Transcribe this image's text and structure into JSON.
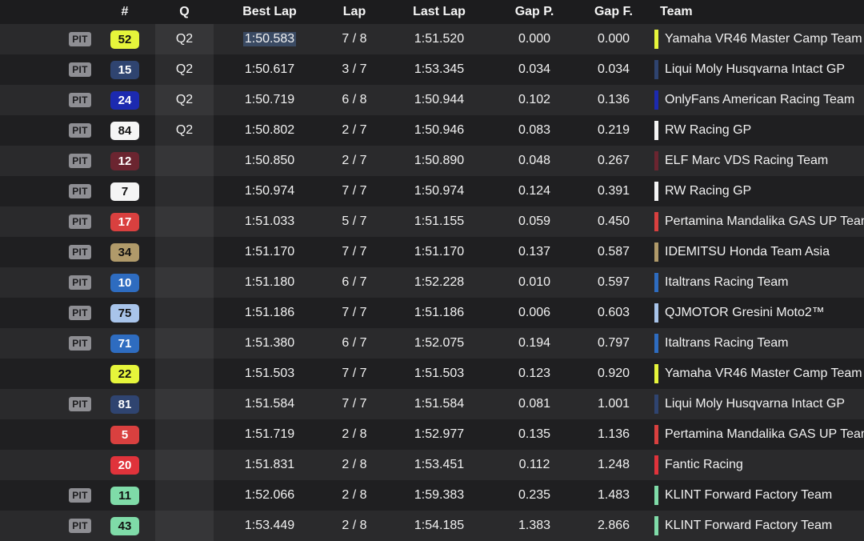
{
  "headers": {
    "num": "#",
    "q": "Q",
    "best": "Best Lap",
    "lap": "Lap",
    "last": "Last Lap",
    "gap_p": "Gap P.",
    "gap_f": "Gap F.",
    "team": "Team"
  },
  "rows": [
    {
      "pit": "PIT",
      "num": "52",
      "num_bg": "#e6f53b",
      "num_fg": "#111111",
      "q": "Q2",
      "best": "1:50.583",
      "lap": "7 / 8",
      "last": "1:51.520",
      "gap_p": "0.000",
      "gap_f": "0.000",
      "team": "Yamaha VR46 Master Camp Team",
      "team_color": "#e6f53b"
    },
    {
      "pit": "PIT",
      "num": "15",
      "num_bg": "#2f4470",
      "num_fg": "#ffffff",
      "q": "Q2",
      "best": "1:50.617",
      "lap": "3 / 7",
      "last": "1:53.345",
      "gap_p": "0.034",
      "gap_f": "0.034",
      "team": "Liqui Moly Husqvarna Intact GP",
      "team_color": "#2f4470"
    },
    {
      "pit": "PIT",
      "num": "24",
      "num_bg": "#1c2ab0",
      "num_fg": "#ffffff",
      "q": "Q2",
      "best": "1:50.719",
      "lap": "6 / 8",
      "last": "1:50.944",
      "gap_p": "0.102",
      "gap_f": "0.136",
      "team": "OnlyFans American Racing Team",
      "team_color": "#1c2ab0"
    },
    {
      "pit": "PIT",
      "num": "84",
      "num_bg": "#f5f5f5",
      "num_fg": "#111111",
      "q": "Q2",
      "best": "1:50.802",
      "lap": "2 / 7",
      "last": "1:50.946",
      "gap_p": "0.083",
      "gap_f": "0.219",
      "team": "RW Racing GP",
      "team_color": "#f5f5f5"
    },
    {
      "pit": "PIT",
      "num": "12",
      "num_bg": "#6b2530",
      "num_fg": "#ffffff",
      "q": "",
      "best": "1:50.850",
      "lap": "2 / 7",
      "last": "1:50.890",
      "gap_p": "0.048",
      "gap_f": "0.267",
      "team": "ELF Marc VDS Racing Team",
      "team_color": "#6b2530"
    },
    {
      "pit": "PIT",
      "num": "7",
      "num_bg": "#f5f5f5",
      "num_fg": "#111111",
      "q": "",
      "best": "1:50.974",
      "lap": "7 / 7",
      "last": "1:50.974",
      "gap_p": "0.124",
      "gap_f": "0.391",
      "team": "RW Racing GP",
      "team_color": "#f5f5f5"
    },
    {
      "pit": "PIT",
      "num": "17",
      "num_bg": "#d9403f",
      "num_fg": "#ffffff",
      "q": "",
      "best": "1:51.033",
      "lap": "5 / 7",
      "last": "1:51.155",
      "gap_p": "0.059",
      "gap_f": "0.450",
      "team": "Pertamina Mandalika GAS UP Team",
      "team_color": "#d9403f"
    },
    {
      "pit": "PIT",
      "num": "34",
      "num_bg": "#b09a6a",
      "num_fg": "#111111",
      "q": "",
      "best": "1:51.170",
      "lap": "7 / 7",
      "last": "1:51.170",
      "gap_p": "0.137",
      "gap_f": "0.587",
      "team": "IDEMITSU Honda Team Asia",
      "team_color": "#b09a6a"
    },
    {
      "pit": "PIT",
      "num": "10",
      "num_bg": "#2e6cc0",
      "num_fg": "#ffffff",
      "q": "",
      "best": "1:51.180",
      "lap": "6 / 7",
      "last": "1:52.228",
      "gap_p": "0.010",
      "gap_f": "0.597",
      "team": "Italtrans Racing Team",
      "team_color": "#2e6cc0"
    },
    {
      "pit": "PIT",
      "num": "75",
      "num_bg": "#a8c4ea",
      "num_fg": "#111111",
      "q": "",
      "best": "1:51.186",
      "lap": "7 / 7",
      "last": "1:51.186",
      "gap_p": "0.006",
      "gap_f": "0.603",
      "team": "QJMOTOR Gresini Moto2™",
      "team_color": "#a8c4ea"
    },
    {
      "pit": "PIT",
      "num": "71",
      "num_bg": "#2e6cc0",
      "num_fg": "#ffffff",
      "q": "",
      "best": "1:51.380",
      "lap": "6 / 7",
      "last": "1:52.075",
      "gap_p": "0.194",
      "gap_f": "0.797",
      "team": "Italtrans Racing Team",
      "team_color": "#2e6cc0"
    },
    {
      "pit": "",
      "num": "22",
      "num_bg": "#e6f53b",
      "num_fg": "#111111",
      "q": "",
      "best": "1:51.503",
      "lap": "7 / 7",
      "last": "1:51.503",
      "gap_p": "0.123",
      "gap_f": "0.920",
      "team": "Yamaha VR46 Master Camp Team",
      "team_color": "#e6f53b"
    },
    {
      "pit": "PIT",
      "num": "81",
      "num_bg": "#2f4470",
      "num_fg": "#ffffff",
      "q": "",
      "best": "1:51.584",
      "lap": "7 / 7",
      "last": "1:51.584",
      "gap_p": "0.081",
      "gap_f": "1.001",
      "team": "Liqui Moly Husqvarna Intact GP",
      "team_color": "#2f4470"
    },
    {
      "pit": "",
      "num": "5",
      "num_bg": "#d9403f",
      "num_fg": "#ffffff",
      "q": "",
      "best": "1:51.719",
      "lap": "2 / 8",
      "last": "1:52.977",
      "gap_p": "0.135",
      "gap_f": "1.136",
      "team": "Pertamina Mandalika GAS UP Team",
      "team_color": "#d9403f"
    },
    {
      "pit": "",
      "num": "20",
      "num_bg": "#e0333b",
      "num_fg": "#ffffff",
      "q": "",
      "best": "1:51.831",
      "lap": "2 / 8",
      "last": "1:53.451",
      "gap_p": "0.112",
      "gap_f": "1.248",
      "team": "Fantic Racing",
      "team_color": "#e0333b"
    },
    {
      "pit": "PIT",
      "num": "11",
      "num_bg": "#7fdba8",
      "num_fg": "#111111",
      "q": "",
      "best": "1:52.066",
      "lap": "2 / 8",
      "last": "1:59.383",
      "gap_p": "0.235",
      "gap_f": "1.483",
      "team": "KLINT Forward Factory Team",
      "team_color": "#7fdba8"
    },
    {
      "pit": "PIT",
      "num": "43",
      "num_bg": "#7fdba8",
      "num_fg": "#111111",
      "q": "",
      "best": "1:53.449",
      "lap": "2 / 8",
      "last": "1:54.185",
      "gap_p": "1.383",
      "gap_f": "2.866",
      "team": "KLINT Forward Factory Team",
      "team_color": "#7fdba8"
    }
  ]
}
